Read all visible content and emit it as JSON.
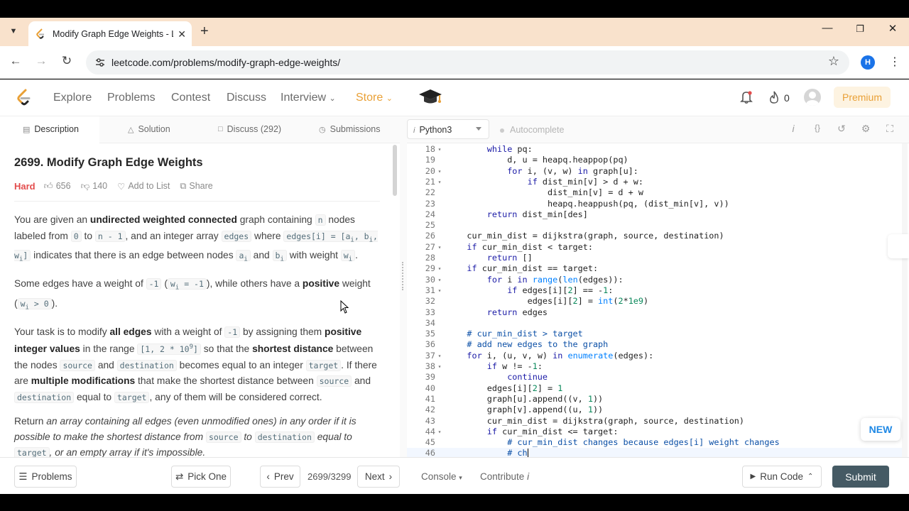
{
  "browser": {
    "tab_title": "Modify Graph Edge Weights - L",
    "url": "leetcode.com/problems/modify-graph-edge-weights/",
    "profile_initial": "H"
  },
  "nav": {
    "links": [
      "Explore",
      "Problems",
      "Contest",
      "Discuss",
      "Interview",
      "Store"
    ],
    "fire_count": "0",
    "premium_label": "Premium"
  },
  "left_tabs": [
    "Description",
    "Solution",
    "Discuss (292)",
    "Submissions"
  ],
  "problem": {
    "title": "2699. Modify Graph Edge Weights",
    "difficulty": "Hard",
    "likes": "656",
    "dislikes": "140",
    "add_to_list": "Add to List",
    "share": "Share"
  },
  "editor": {
    "language": "Python3",
    "autocomplete": "Autocomplete",
    "lines": [
      {
        "n": "18",
        "fold": true,
        "indent": 8,
        "code": "while pq:"
      },
      {
        "n": "19",
        "fold": false,
        "indent": 12,
        "code": "d, u = heapq.heappop(pq)"
      },
      {
        "n": "20",
        "fold": true,
        "indent": 12,
        "code": "for i, (v, w) in graph[u]:"
      },
      {
        "n": "21",
        "fold": true,
        "indent": 16,
        "code": "if dist_min[v] > d + w:"
      },
      {
        "n": "22",
        "fold": false,
        "indent": 20,
        "code": "dist_min[v] = d + w"
      },
      {
        "n": "23",
        "fold": false,
        "indent": 20,
        "code": "heapq.heappush(pq, (dist_min[v], v))"
      },
      {
        "n": "24",
        "fold": false,
        "indent": 8,
        "code": "return dist_min[des]"
      },
      {
        "n": "25",
        "fold": false,
        "indent": 0,
        "code": ""
      },
      {
        "n": "26",
        "fold": false,
        "indent": 4,
        "code": "cur_min_dist = dijkstra(graph, source, destination)"
      },
      {
        "n": "27",
        "fold": true,
        "indent": 4,
        "code": "if cur_min_dist < target:"
      },
      {
        "n": "28",
        "fold": false,
        "indent": 8,
        "code": "return []"
      },
      {
        "n": "29",
        "fold": true,
        "indent": 4,
        "code": "if cur_min_dist == target:"
      },
      {
        "n": "30",
        "fold": true,
        "indent": 8,
        "code": "for i in range(len(edges)):"
      },
      {
        "n": "31",
        "fold": true,
        "indent": 12,
        "code": "if edges[i][2] == -1:"
      },
      {
        "n": "32",
        "fold": false,
        "indent": 16,
        "code": "edges[i][2] = int(2*1e9)"
      },
      {
        "n": "33",
        "fold": false,
        "indent": 8,
        "code": "return edges"
      },
      {
        "n": "34",
        "fold": false,
        "indent": 0,
        "code": ""
      },
      {
        "n": "35",
        "fold": false,
        "indent": 4,
        "code": "# cur_min_dist > target"
      },
      {
        "n": "36",
        "fold": false,
        "indent": 4,
        "code": "# add new edges to the graph"
      },
      {
        "n": "37",
        "fold": true,
        "indent": 4,
        "code": "for i, (u, v, w) in enumerate(edges):"
      },
      {
        "n": "38",
        "fold": true,
        "indent": 8,
        "code": "if w != -1:"
      },
      {
        "n": "39",
        "fold": false,
        "indent": 12,
        "code": "continue"
      },
      {
        "n": "40",
        "fold": false,
        "indent": 8,
        "code": "edges[i][2] = 1"
      },
      {
        "n": "41",
        "fold": false,
        "indent": 8,
        "code": "graph[u].append((v, 1))"
      },
      {
        "n": "42",
        "fold": false,
        "indent": 8,
        "code": "graph[v].append((u, 1))"
      },
      {
        "n": "43",
        "fold": false,
        "indent": 8,
        "code": "cur_min_dist = dijkstra(graph, source, destination)"
      },
      {
        "n": "44",
        "fold": true,
        "indent": 8,
        "code": "if cur_min_dist <= target:"
      },
      {
        "n": "45",
        "fold": false,
        "indent": 12,
        "code": "# cur_min_dist changes because edges[i] weight changes"
      },
      {
        "n": "46",
        "fold": false,
        "indent": 12,
        "code": "# ch"
      }
    ],
    "new_badge": "NEW"
  },
  "bottom": {
    "problems": "Problems",
    "pick_one": "Pick One",
    "prev": "Prev",
    "counter": "2699/3299",
    "next": "Next",
    "console": "Console",
    "contribute": "Contribute",
    "run_code": "Run Code",
    "submit": "Submit"
  }
}
